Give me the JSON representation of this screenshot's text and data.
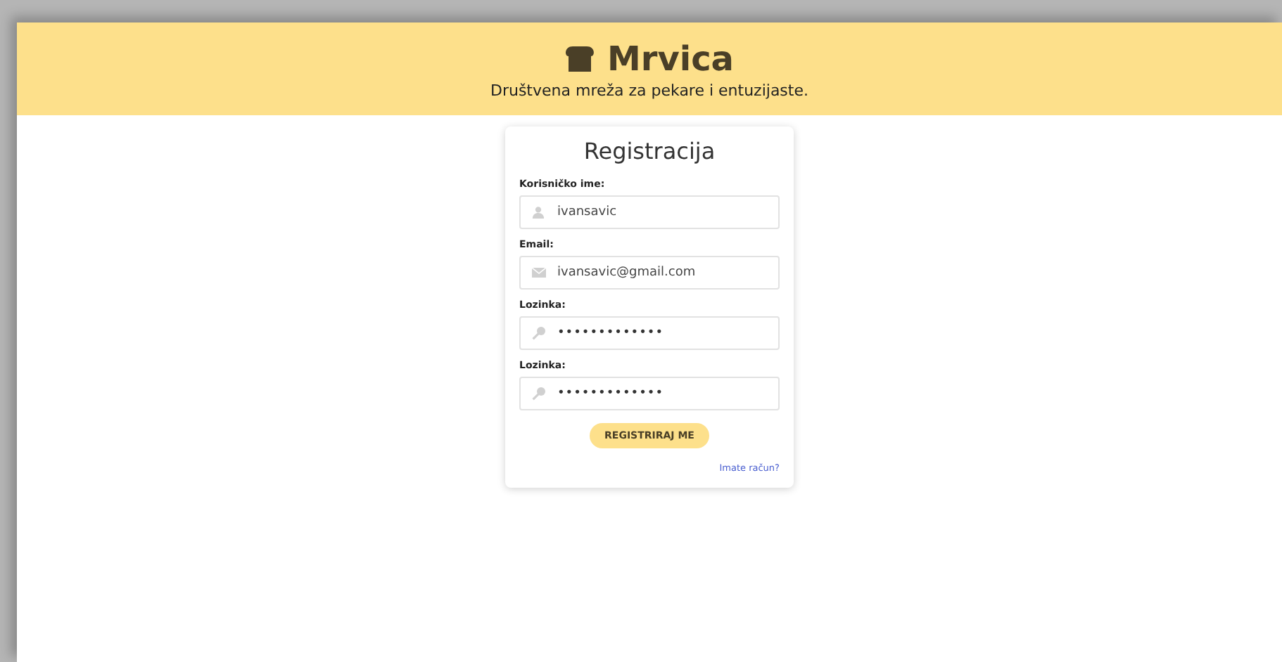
{
  "header": {
    "title": "Mrvica",
    "subtitle": "Društvena mreža za pekare i entuzijaste."
  },
  "form": {
    "title": "Registracija",
    "fields": [
      {
        "label": "Korisničko ime:",
        "kind": "user",
        "value": "ivansavic"
      },
      {
        "label": "Email:",
        "kind": "email",
        "value": "ivansavic@gmail.com"
      },
      {
        "label": "Lozinka:",
        "kind": "password",
        "value": "•••••••••••••"
      },
      {
        "label": "Lozinka:",
        "kind": "password",
        "value": "•••••••••••••"
      }
    ],
    "submit": "REGISTRIRAJ ME",
    "link": "Imate račun?"
  }
}
